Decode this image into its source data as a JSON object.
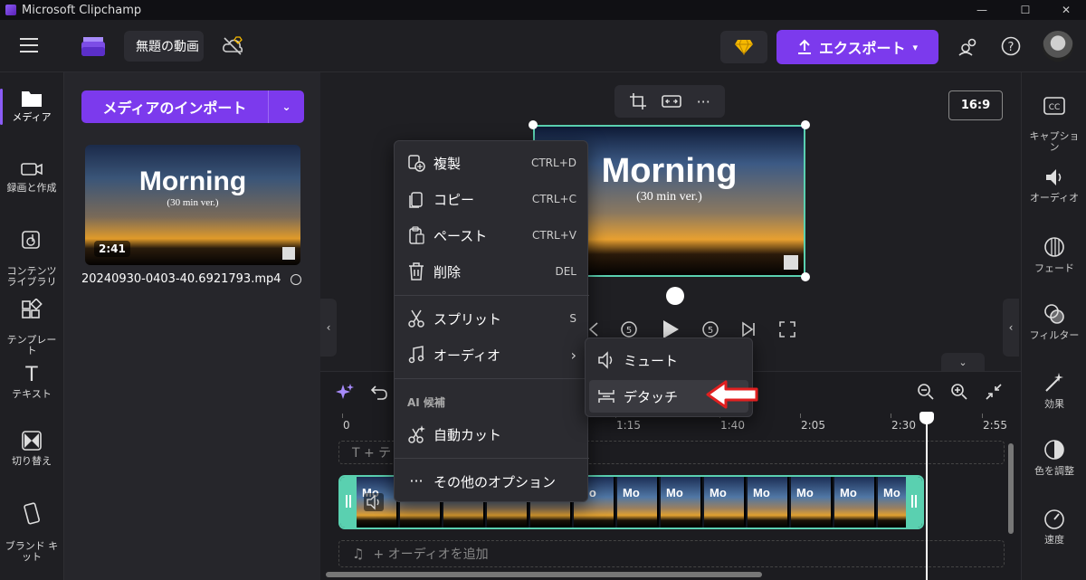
{
  "window": {
    "title": "Microsoft Clipchamp"
  },
  "topbar": {
    "project_name": "無題の動画",
    "export_label": "エクスポート"
  },
  "left_nav": [
    {
      "label": "メディア"
    },
    {
      "label": "録画と作成"
    },
    {
      "label": "コンテンツ\nライブラリ"
    },
    {
      "label": "テンプレー\nト"
    },
    {
      "label": "テキスト"
    },
    {
      "label": "切り替え"
    },
    {
      "label": "ブランド キ\nット"
    }
  ],
  "media": {
    "import_label": "メディアのインポート",
    "thumb_title": "Morning",
    "thumb_subtitle": "(30 min ver.)",
    "duration": "2:41",
    "filename": "20240930-0403-40.6921793.mp4"
  },
  "preview": {
    "aspect_ratio": "16:9",
    "title": "Morning",
    "subtitle": "(30 min ver.)"
  },
  "right_nav": [
    {
      "label": "キャプショ\nン"
    },
    {
      "label": "オーディオ"
    },
    {
      "label": "フェード"
    },
    {
      "label": "フィルター"
    },
    {
      "label": "効果"
    },
    {
      "label": "色を調整"
    },
    {
      "label": "速度"
    }
  ],
  "context_menu": {
    "items": [
      {
        "label": "複製",
        "shortcut": "CTRL+D"
      },
      {
        "label": "コピー",
        "shortcut": "CTRL+C"
      },
      {
        "label": "ペースト",
        "shortcut": "CTRL+V"
      },
      {
        "label": "削除",
        "shortcut": "DEL"
      },
      {
        "label": "スプリット",
        "shortcut": "S"
      },
      {
        "label": "オーディオ",
        "shortcut": ""
      }
    ],
    "ai_header": "AI 候補",
    "auto_cut": "自動カット",
    "more_options": "その他のオプション"
  },
  "audio_submenu": {
    "mute": "ミュート",
    "detach": "デタッチ"
  },
  "timeline": {
    "ticks": [
      "0",
      "1:15",
      "1:40",
      "2:05",
      "2:30",
      "2:55"
    ],
    "text_track": "T + テ",
    "clip_label": "Mo",
    "audio_track": "+ オーディオを追加"
  }
}
